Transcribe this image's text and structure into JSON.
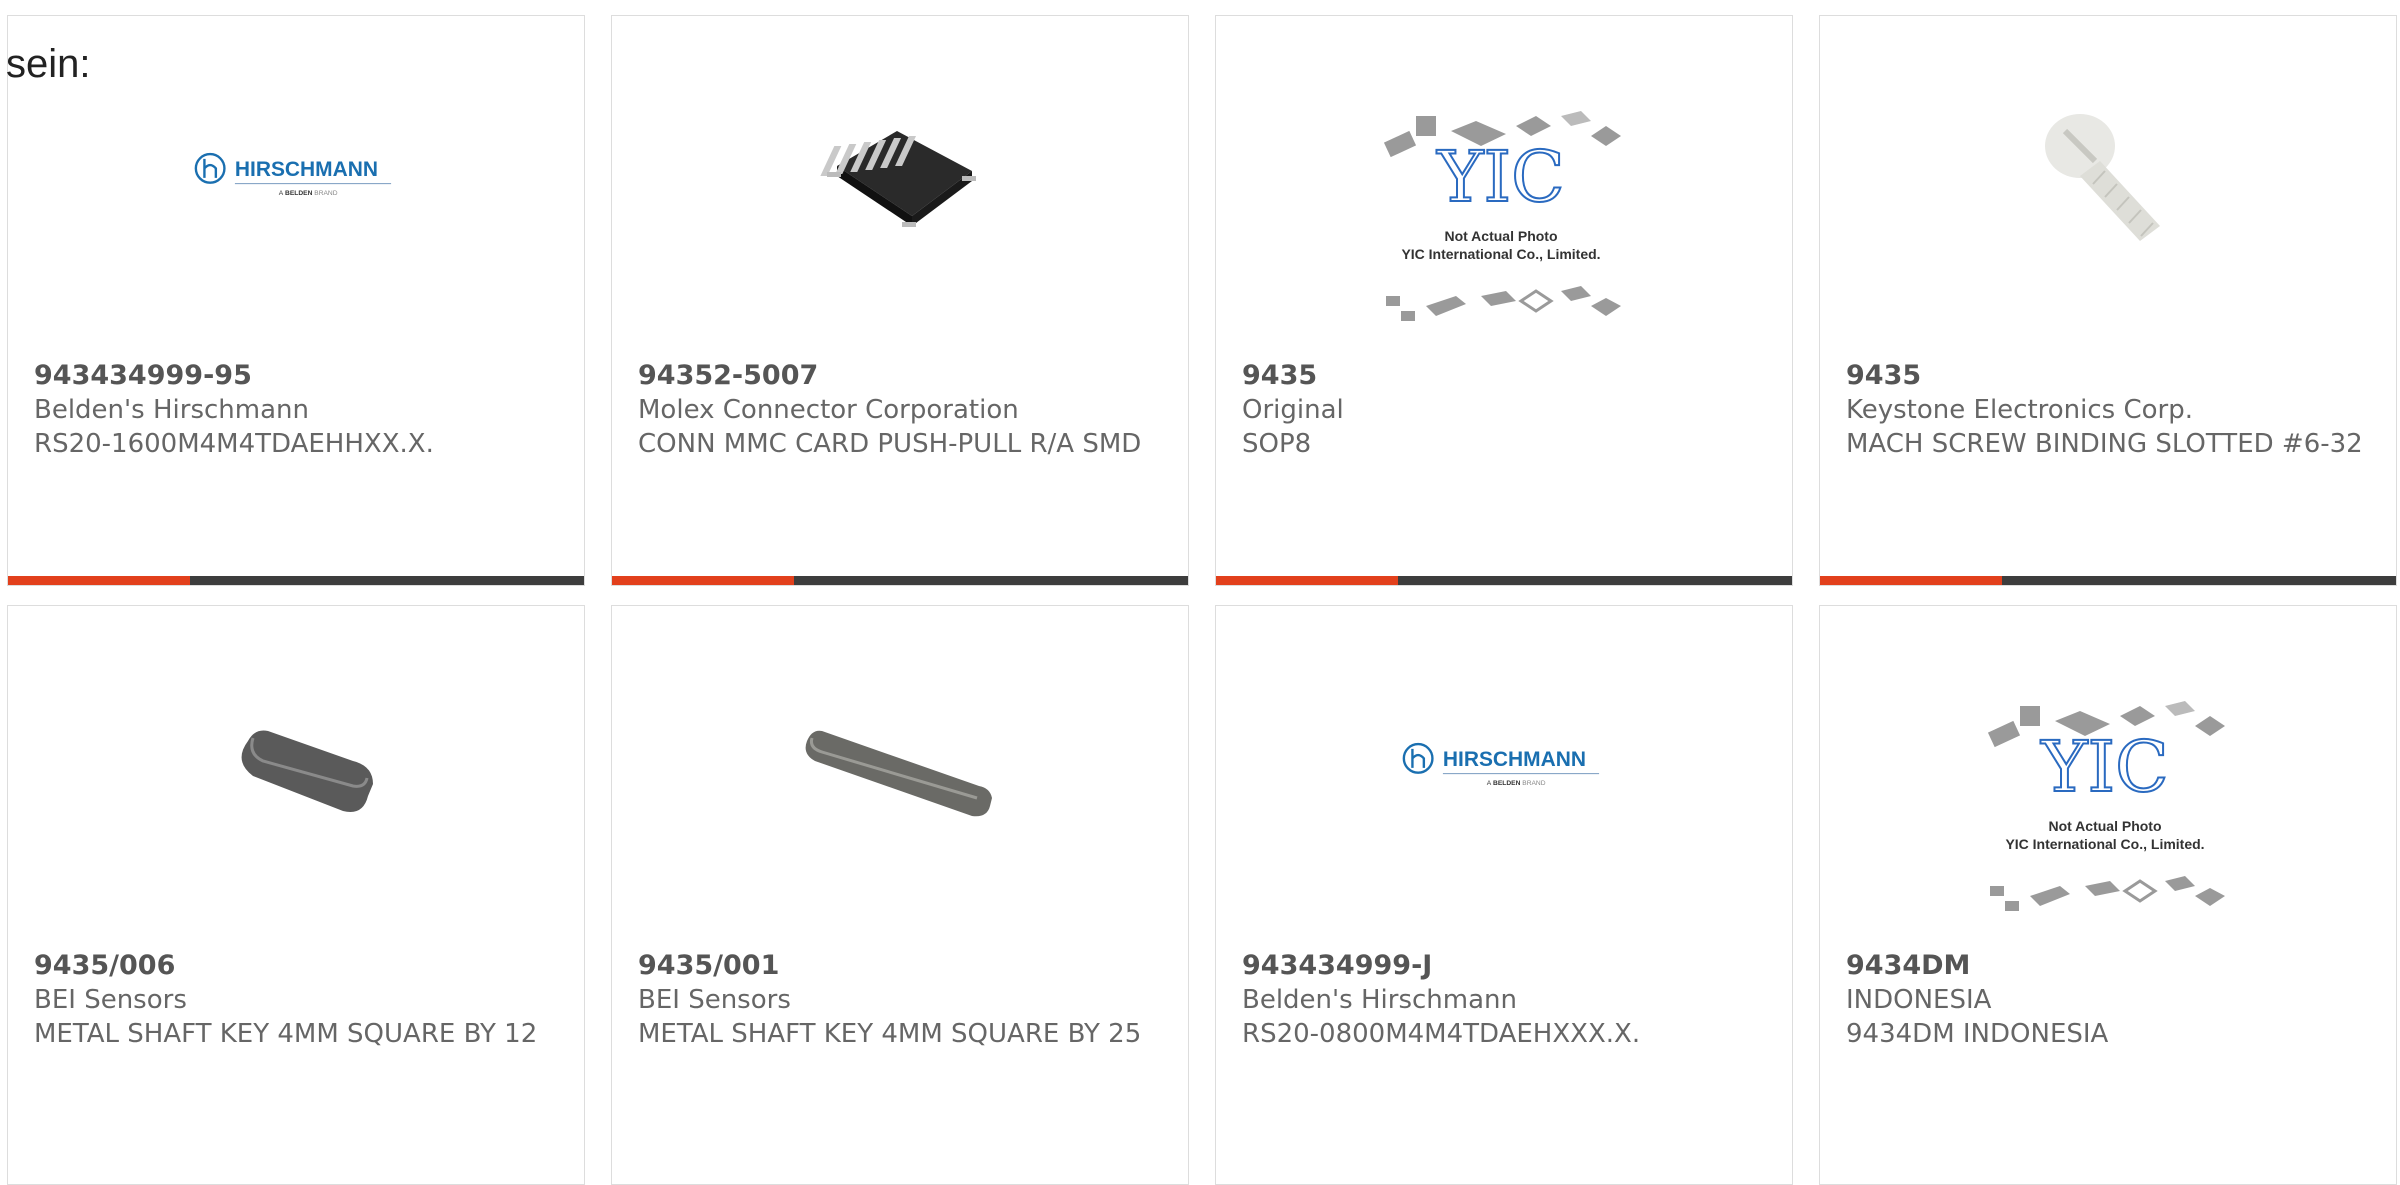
{
  "intro_text": "sein:",
  "colors": {
    "accent": "#e2401c",
    "bar": "#3d3d3d",
    "brand_blue": "#1a6fb0"
  },
  "logos": {
    "hirschmann": {
      "name": "HIRSCHMANN",
      "tagline_prefix": "A",
      "tagline_brand": "BELDEN",
      "tagline_suffix": "BRAND"
    },
    "yic": {
      "mark": "YIC",
      "line1": "Not Actual Photo",
      "line2": "YIC International Co., Limited."
    }
  },
  "products": [
    {
      "part_number": "943434999-95",
      "manufacturer": "Belden's Hirschmann",
      "description": "RS20-1600M4M4TDAEHHXX.X.",
      "image": "hirschmann-logo"
    },
    {
      "part_number": "94352-5007",
      "manufacturer": "Molex Connector Corporation",
      "description": "CONN MMC CARD PUSH-PULL R/A SMD",
      "image": "card-connector"
    },
    {
      "part_number": "9435",
      "manufacturer": "Original",
      "description": "SOP8",
      "image": "yic-placeholder"
    },
    {
      "part_number": "9435",
      "manufacturer": "Keystone Electronics Corp.",
      "description": "MACH SCREW BINDING SLOTTED #6-32",
      "image": "nylon-screw"
    },
    {
      "part_number": "9435/006",
      "manufacturer": "BEI Sensors",
      "description": "METAL SHAFT KEY 4MM SQUARE BY 12",
      "image": "shaft-key-short"
    },
    {
      "part_number": "9435/001",
      "manufacturer": "BEI Sensors",
      "description": "METAL SHAFT KEY 4MM SQUARE BY 25",
      "image": "shaft-key-long"
    },
    {
      "part_number": "943434999-J",
      "manufacturer": "Belden's Hirschmann",
      "description": "RS20-0800M4M4TDAEHXXX.X.",
      "image": "hirschmann-logo"
    },
    {
      "part_number": "9434DM",
      "manufacturer": "INDONESIA",
      "description": "9434DM INDONESIA",
      "image": "yic-placeholder"
    }
  ]
}
